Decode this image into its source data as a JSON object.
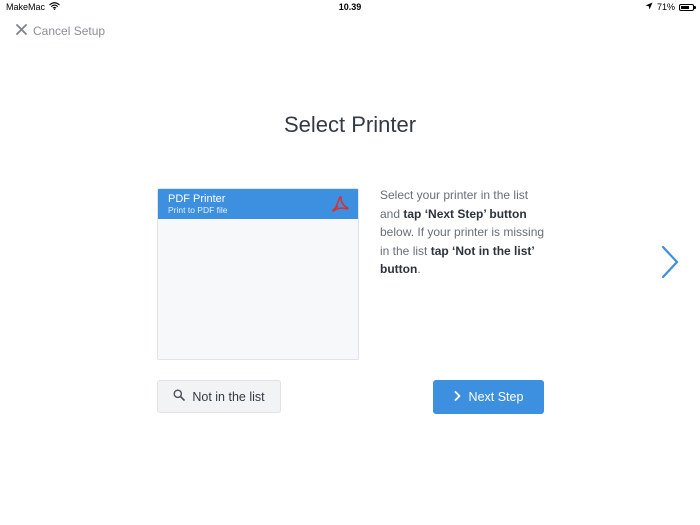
{
  "status_bar": {
    "carrier": "MakeMac",
    "time": "10.39",
    "battery_percent": "71%",
    "battery_level": 0.71,
    "icons": [
      "wifi-icon",
      "location-arrow-icon",
      "battery-icon"
    ]
  },
  "header": {
    "cancel_label": "Cancel Setup",
    "cancel_icon": "close-icon"
  },
  "main": {
    "title": "Select Printer",
    "printers": [
      {
        "name": "PDF Printer",
        "description": "Print to PDF file",
        "icon": "acrobat-pdf-icon",
        "selected": true
      }
    ],
    "instructions": {
      "part1": "Select your printer in the list and ",
      "bold1": "tap ‘Next Step’ button",
      "part2": " below. If your printer is missing in the list ",
      "bold2": "tap ‘Not in the list’ button",
      "part3": "."
    },
    "not_in_list_label": "Not in the list",
    "next_step_label": "Next Step",
    "next_icon": "chevron-right-icon"
  },
  "colors": {
    "accent": "#3d8fe0",
    "title_text": "#343a45",
    "muted_text": "#8a8f96",
    "pdf_red": "#d9302a"
  }
}
